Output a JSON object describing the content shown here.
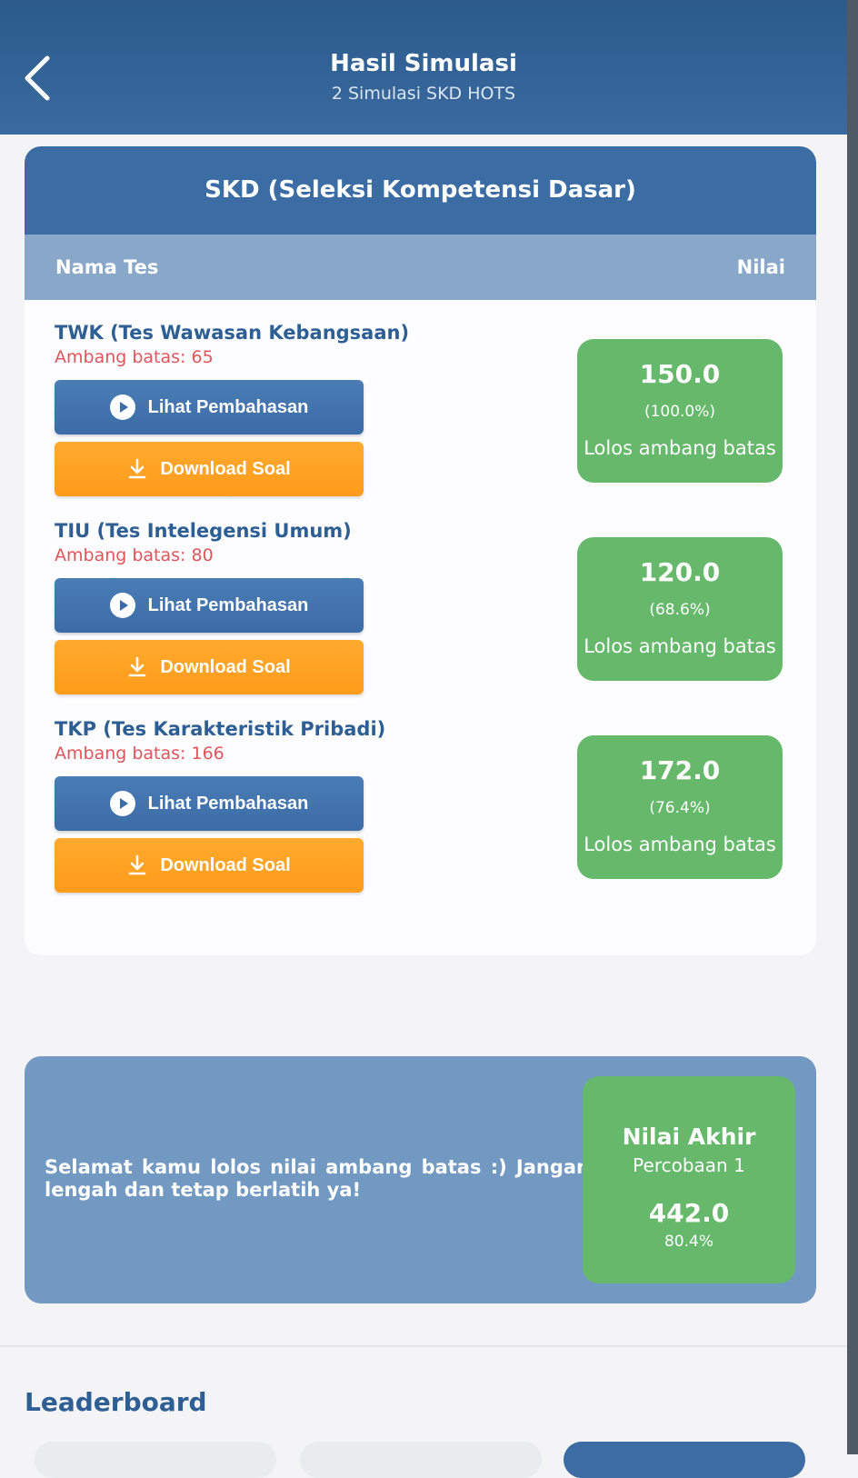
{
  "header": {
    "title": "Hasil Simulasi",
    "subtitle": "2 Simulasi SKD HOTS"
  },
  "card": {
    "title": "SKD (Seleksi Kompetensi Dasar)",
    "col_name": "Nama Tes",
    "col_score": "Nilai"
  },
  "tests": [
    {
      "name": "TWK (Tes Wawasan Kebangsaan)",
      "threshold": "Ambang batas: 65",
      "review_label": "Lihat Pembahasan",
      "download_label": "Download Soal",
      "score": "150.0",
      "percent": "(100.0%)",
      "status": "Lolos ambang batas"
    },
    {
      "name": "TIU (Tes Intelegensi Umum)",
      "threshold": "Ambang batas: 80",
      "review_label": "Lihat Pembahasan",
      "download_label": "Download Soal",
      "score": "120.0",
      "percent": "(68.6%)",
      "status": "Lolos ambang batas"
    },
    {
      "name": "TKP (Tes Karakteristik Pribadi)",
      "threshold": "Ambang batas: 166",
      "review_label": "Lihat Pembahasan",
      "download_label": "Download Soal",
      "score": "172.0",
      "percent": "(76.4%)",
      "status": "Lolos ambang batas"
    }
  ],
  "final": {
    "message": "Selamat kamu lolos nilai ambang batas :) Jangan lengah dan tetap berlatih ya!",
    "title": "Nilai Akhir",
    "attempt": "Percobaan 1",
    "score": "442.0",
    "percent": "80.4%"
  },
  "leaderboard": {
    "title": "Leaderboard"
  },
  "icons": {
    "back": "chevron-left-icon",
    "play": "play-circle-icon",
    "download": "download-icon"
  },
  "colors": {
    "header_blue": "#3a6aa0",
    "button_blue": "#3b6ca6",
    "button_orange": "#ff9b1a",
    "score_green": "#66b96b",
    "threshold_red": "#e0555a"
  }
}
